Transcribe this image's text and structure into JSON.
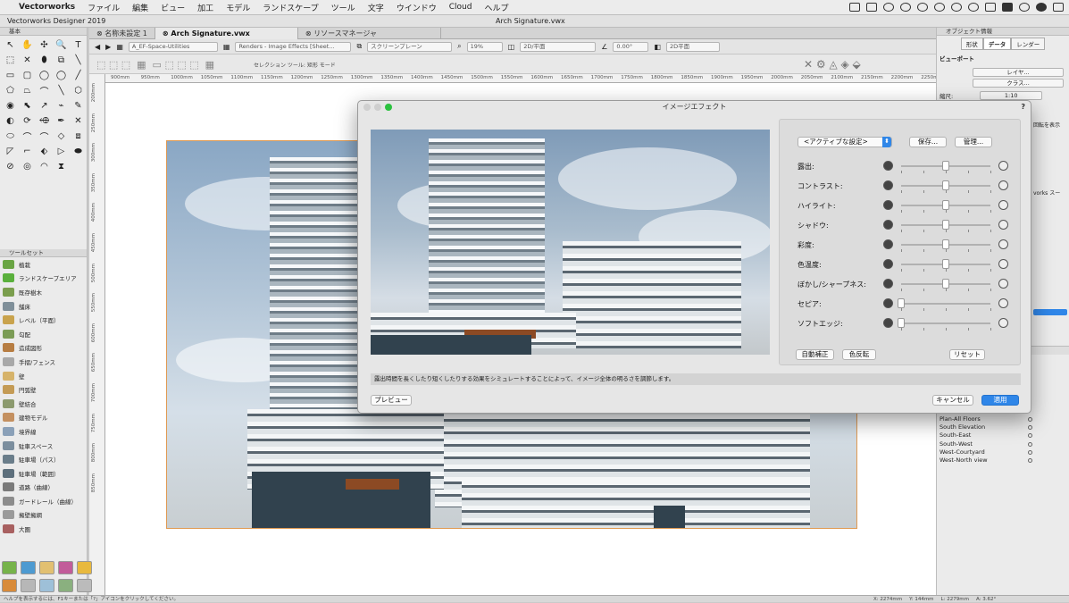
{
  "menubar": {
    "apple": "",
    "app": "Vectorworks",
    "items": [
      "ファイル",
      "編集",
      "ビュー",
      "加工",
      "モデル",
      "ランドスケープ",
      "ツール",
      "文字",
      "ウインドウ",
      "Cloud",
      "ヘルプ"
    ]
  },
  "titlebar": {
    "app_title": "Vectorworks Designer 2019",
    "doc_title": "Arch Signature.vwx"
  },
  "tabs": [
    "名称未設定 1",
    "Arch Signature.vwx",
    "リソースマネージャ"
  ],
  "viewbar": {
    "class_field": "A_EF-Space-Utilities",
    "layer_field": "Renders - Image Effects [Sheet...",
    "plane_field": "スクリーンプレーン",
    "zoom": "19%",
    "view": "2D/平面",
    "angle": "0.00°",
    "view2": "2D平面"
  },
  "modebar": {
    "text": "セレクション ツール: 矩形 モード"
  },
  "ruler_h": [
    "900mm",
    "950mm",
    "1000mm",
    "1050mm",
    "1100mm",
    "1150mm",
    "1200mm",
    "1250mm",
    "1300mm",
    "1350mm",
    "1400mm",
    "1450mm",
    "1500mm",
    "1550mm",
    "1600mm",
    "1650mm",
    "1700mm",
    "1750mm",
    "1800mm",
    "1850mm",
    "1900mm",
    "1950mm",
    "2000mm",
    "2050mm",
    "2100mm",
    "2150mm",
    "2200mm",
    "2250mm"
  ],
  "ruler_v": [
    "200mm",
    "250mm",
    "300mm",
    "350mm",
    "400mm",
    "450mm",
    "500mm",
    "550mm",
    "600mm",
    "650mm",
    "700mm",
    "750mm",
    "800mm",
    "850mm"
  ],
  "tool_palette": {
    "title": "基本",
    "tools": [
      "↖",
      "✋",
      "✣",
      "🔍",
      "T",
      "⬚",
      "✕",
      "⬮",
      "⧉",
      "╲",
      "▭",
      "▢",
      "◯",
      "◯",
      "╱",
      "⬠",
      "⏢",
      "⌒",
      "╲",
      "⬡",
      "◉",
      "⬉",
      "↗",
      "⌁",
      "✎",
      "◐",
      "⟳",
      "⬲",
      "✒",
      "✕",
      "⬭",
      "⌒",
      "⌒",
      "◇",
      "⧈",
      "◸",
      "⌐",
      "⬖",
      "▷",
      "⬬",
      "⊘",
      "◎",
      "◠",
      "⧗",
      ""
    ]
  },
  "toolset": {
    "title": "ツールセット",
    "items": [
      "植栽",
      "ランドスケープエリア",
      "既存樹木",
      "舗床",
      "レベル（平面）",
      "勾配",
      "造成図形",
      "手摺/フェンス",
      "壁",
      "円弧壁",
      "壁結合",
      "建物モデル",
      "境界線",
      "駐車スペース",
      "駐車場（パス）",
      "駐車場（範囲）",
      "道路（曲線）",
      "ガードレール（曲線）",
      "擁壁擁網",
      "大圏"
    ]
  },
  "obj_info": {
    "title": "オブジェクト情報",
    "tabs": [
      "形状",
      "データ",
      "レンダー"
    ],
    "subtitle": "ビューポート",
    "buttons": [
      "レイヤ...",
      "クラス..."
    ],
    "scale_label": "縮尺:",
    "scale_value": "1:10",
    "side_texts": [
      "回転を表示",
      "vorks スー"
    ],
    "views": [
      "Plan-All Floors",
      "South Elevation",
      "South-East",
      "South-West",
      "West-Courtyard",
      "West-North view"
    ]
  },
  "dialog": {
    "title": "イメージエフェクト",
    "help": "?",
    "preset": "<アクティブな設定>",
    "save": "保存...",
    "manage": "管理...",
    "sliders": [
      {
        "label": "露出:",
        "value": 0.5
      },
      {
        "label": "コントラスト:",
        "value": 0.5
      },
      {
        "label": "ハイライト:",
        "value": 0.5
      },
      {
        "label": "シャドウ:",
        "value": 0.5
      },
      {
        "label": "彩度:",
        "value": 0.5
      },
      {
        "label": "色温度:",
        "value": 0.5
      },
      {
        "label": "ぼかし/シャープネス:",
        "value": 0.5
      },
      {
        "label": "セピア:",
        "value": 0.0
      },
      {
        "label": "ソフトエッジ:",
        "value": 0.0
      }
    ],
    "auto": "自動補正",
    "invert": "色反転",
    "reset": "リセット",
    "description": "露出時間を長くしたり短くしたりする効果をシミュレートすることによって、イメージ全体の明るさを調節します。",
    "preview": "プレビュー",
    "cancel": "キャンセル",
    "apply": "適用"
  },
  "status": {
    "help": "ヘルプを表示するには、F1キーまたは「?」アイコンをクリックしてください。",
    "x": "X: 2274mm",
    "y": "Y: 144mm",
    "l": "L: 2279mm",
    "a": "A: 3.62°"
  }
}
